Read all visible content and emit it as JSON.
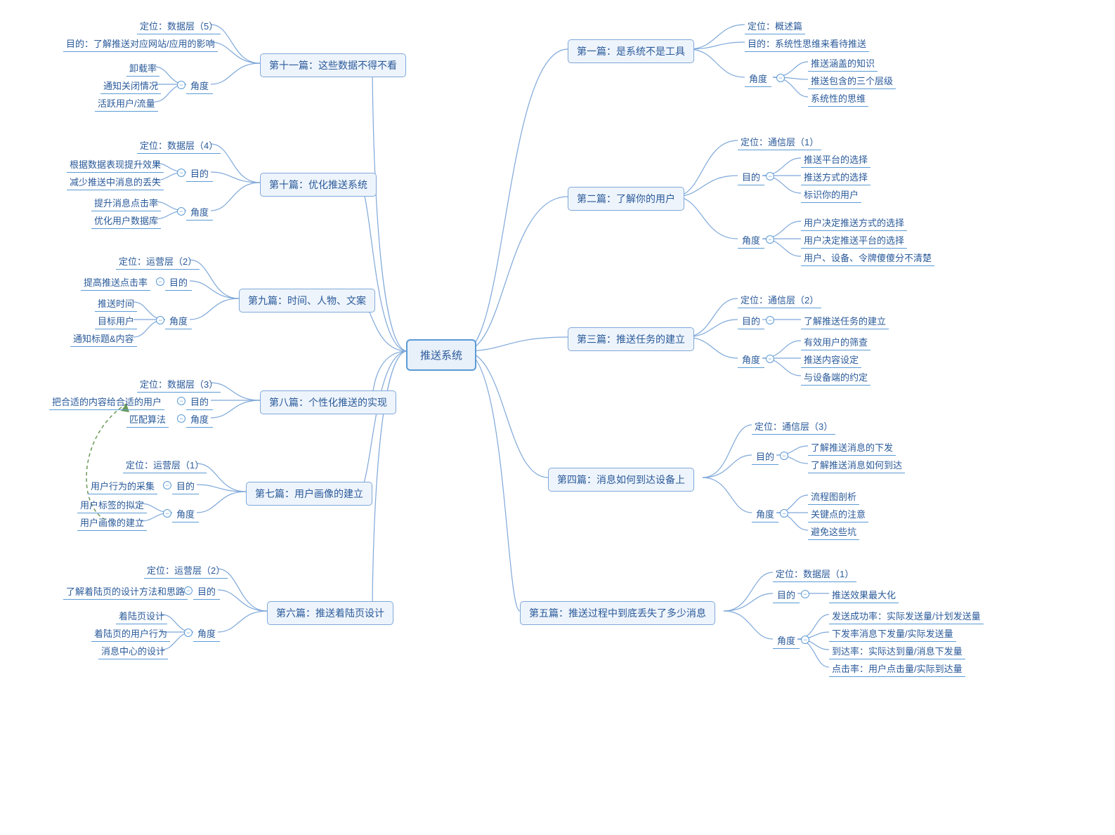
{
  "root": "推送系统",
  "chapters": [
    {
      "title": "第一篇：是系统不是工具",
      "pos": "定位：概述篇",
      "purpose_label": "目的：系统性思维来看待推送",
      "angle_label": "角度",
      "angles": [
        "推送涵盖的知识",
        "推送包含的三个层级",
        "系统性的思维"
      ]
    },
    {
      "title": "第二篇：了解你的用户",
      "pos": "定位：通信层（1）",
      "purpose_label": "目的",
      "purposes": [
        "推送平台的选择",
        "推送方式的选择",
        "标识你的用户"
      ],
      "angle_label": "角度",
      "angles": [
        "用户决定推送方式的选择",
        "用户决定推送平台的选择",
        "用户、设备、令牌傻傻分不清楚"
      ]
    },
    {
      "title": "第三篇：推送任务的建立",
      "pos": "定位：通信层（2）",
      "purpose_label": "目的",
      "purpose_single": "了解推送任务的建立",
      "angle_label": "角度",
      "angles": [
        "有效用户的筛查",
        "推送内容设定",
        "与设备端的约定"
      ]
    },
    {
      "title": "第四篇：消息如何到达设备上",
      "pos": "定位：通信层（3）",
      "purpose_label": "目的",
      "purposes": [
        "了解推送消息的下发",
        "了解推送消息如何到达"
      ],
      "angle_label": "角度",
      "angles": [
        "流程图剖析",
        "关键点的注意",
        "避免这些坑"
      ]
    },
    {
      "title": "第五篇：推送过程中到底丢失了多少消息",
      "pos": "定位：数据层（1）",
      "purpose_label": "目的",
      "purpose_single": "推送效果最大化",
      "angle_label": "角度",
      "angles": [
        "发送成功率：实际发送量/计划发送量",
        "下发率消息下发量/实际发送量",
        "到达率：实际达到量/消息下发量",
        "点击率：用户点击量/实际到达量"
      ]
    },
    {
      "title": "第六篇：推送着陆页设计",
      "pos": "定位：运营层（2）",
      "purpose_label": "目的",
      "purpose_single": "了解着陆页的设计方法和思路",
      "angle_label": "角度",
      "angles": [
        "着陆页设计",
        "着陆页的用户行为",
        "消息中心的设计"
      ]
    },
    {
      "title": "第七篇：用户画像的建立",
      "pos": "定位：运营层（1）",
      "purpose_label": "目的",
      "purpose_single": "用户行为的采集",
      "angle_label": "角度",
      "angles": [
        "用户标签的拟定",
        "用户画像的建立"
      ]
    },
    {
      "title": "第八篇：个性化推送的实现",
      "pos": "定位：数据层（3）",
      "purpose_label": "目的",
      "purpose_single": "把合适的内容给合适的用户",
      "angle_label": "角度",
      "angle_single": "匹配算法"
    },
    {
      "title": "第九篇：时间、人物、文案",
      "pos": "定位：运营层（2）",
      "purpose_label": "目的",
      "purpose_single": "提高推送点击率",
      "angle_label": "角度",
      "angles": [
        "推送时间",
        "目标用户",
        "通知标题&内容"
      ]
    },
    {
      "title": "第十篇：优化推送系统",
      "pos": "定位：数据层（4）",
      "purpose_label": "目的",
      "purposes": [
        "根据数据表现提升效果",
        "减少推送中消息的丢失"
      ],
      "angle_label": "角度",
      "angles": [
        "提升消息点击率",
        "优化用户数据库"
      ]
    },
    {
      "title": "第十一篇：这些数据不得不看",
      "pos": "定位：数据层（5）",
      "purpose_label": "目的：了解推送对应网站/应用的影响",
      "angle_label": "角度",
      "angles": [
        "卸载率",
        "通知关闭情况",
        "活跃用户/流量"
      ]
    }
  ]
}
